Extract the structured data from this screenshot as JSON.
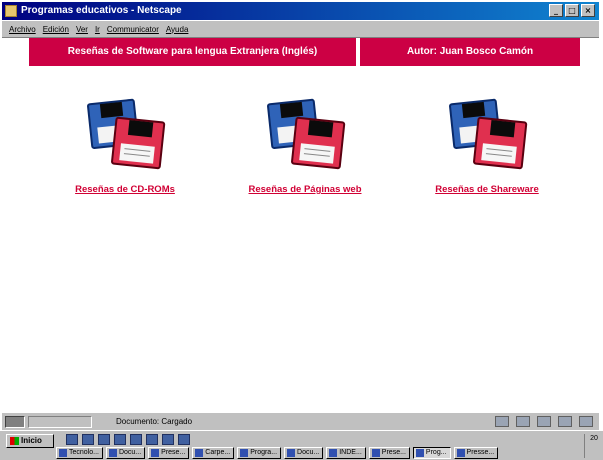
{
  "window": {
    "title": "Programas educativos - Netscape",
    "controls": [
      "_",
      "□",
      "×"
    ]
  },
  "menu": [
    "Archivo",
    "Edición",
    "Ver",
    "Ir",
    "Communicator",
    "Ayuda"
  ],
  "banners": {
    "left": "Reseñas de Software para lengua Extranjera (Inglés)",
    "right": "Autor: Juan Bosco Camón"
  },
  "cards": [
    {
      "icon": "floppy-disks-icon",
      "label": "Reseñas de CD-ROMs"
    },
    {
      "icon": "floppy-disks-icon",
      "label": "Reseñas de Páginas web"
    },
    {
      "icon": "floppy-disks-icon",
      "label": "Reseñas de Shareware"
    }
  ],
  "status": {
    "text": "Documento: Cargado"
  },
  "taskbar": {
    "start": "Inicio",
    "tasks": [
      "Tecnolo...",
      "Docu...",
      "Prese...",
      "Carpe...",
      "Progra...",
      "Docu...",
      "INDE...",
      "Prese...",
      "Prog...",
      "Presse..."
    ],
    "clock": "20"
  },
  "colors": {
    "banner": "#cc0044",
    "link": "#d10034",
    "titlebar": "#000080"
  }
}
